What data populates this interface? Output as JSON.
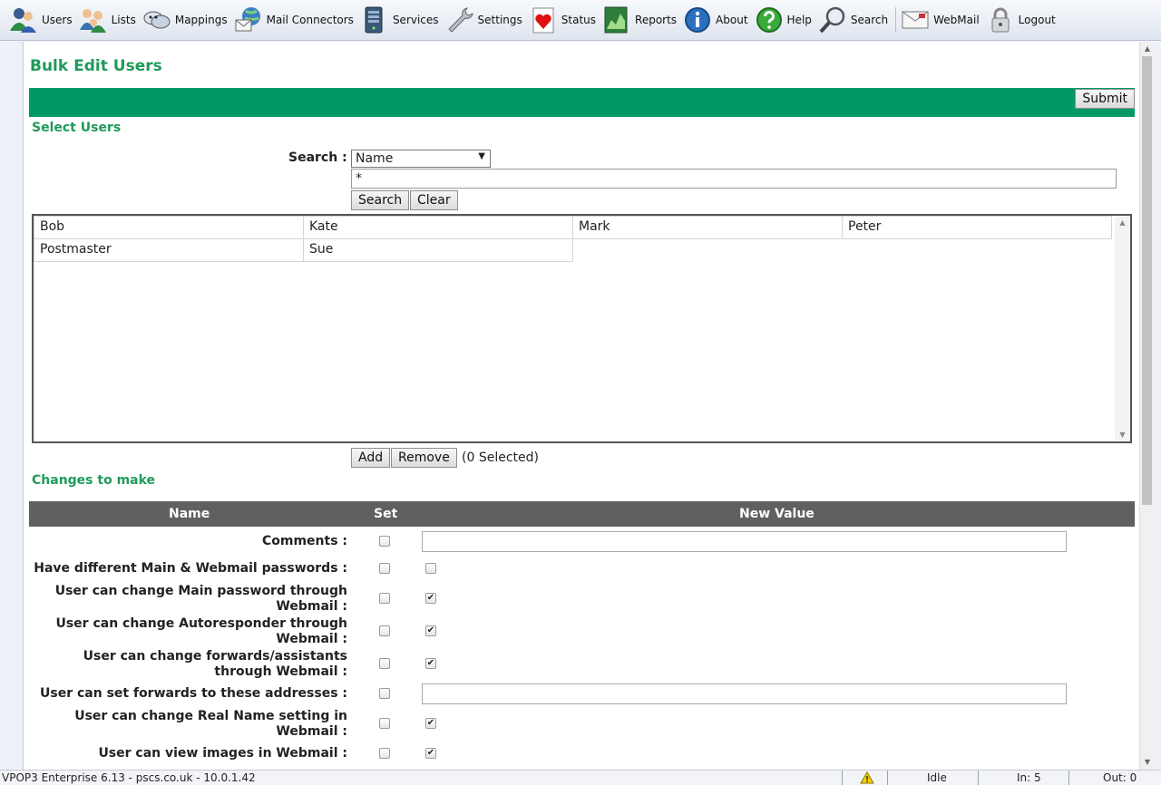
{
  "toolbar": {
    "items": [
      {
        "label": "Users",
        "icon": "users-icon"
      },
      {
        "label": "Lists",
        "icon": "lists-icon"
      },
      {
        "label": "Mappings",
        "icon": "mappings-icon"
      },
      {
        "label": "Mail Connectors",
        "icon": "mail-connectors-icon"
      },
      {
        "label": "Services",
        "icon": "services-icon"
      },
      {
        "label": "Settings",
        "icon": "settings-icon"
      },
      {
        "label": "Status",
        "icon": "status-icon"
      },
      {
        "label": "Reports",
        "icon": "reports-icon"
      },
      {
        "label": "About",
        "icon": "about-icon"
      },
      {
        "label": "Help",
        "icon": "help-icon"
      },
      {
        "label": "Search",
        "icon": "search-icon"
      },
      {
        "label": "WebMail",
        "icon": "webmail-icon"
      },
      {
        "label": "Logout",
        "icon": "logout-icon"
      }
    ]
  },
  "page": {
    "title": "Bulk Edit Users",
    "submit_label": "Submit",
    "select_users_title": "Select Users",
    "changes_title": "Changes to make"
  },
  "search": {
    "label": "Search :",
    "field_selected": "Name",
    "query_value": "*",
    "search_button": "Search",
    "clear_button": "Clear"
  },
  "users": [
    "Bob",
    "Kate",
    "Mark",
    "Peter",
    "Postmaster",
    "Sue"
  ],
  "selection": {
    "add_button": "Add",
    "remove_button": "Remove",
    "selected_text": "(0 Selected)"
  },
  "changes": {
    "headers": {
      "name": "Name",
      "set": "Set",
      "new_value": "New Value"
    },
    "rows": [
      {
        "label": "Comments :",
        "set": false,
        "value_type": "text"
      },
      {
        "label": "Have different Main & Webmail passwords :",
        "set": false,
        "value_type": "checkbox",
        "value": false
      },
      {
        "label": "User can change Main password through Webmail :",
        "set": false,
        "value_type": "checkbox",
        "value": true
      },
      {
        "label": "User can change Autoresponder through Webmail :",
        "set": false,
        "value_type": "checkbox",
        "value": true
      },
      {
        "label": "User can change forwards/assistants through Webmail :",
        "set": false,
        "value_type": "checkbox",
        "value": true
      },
      {
        "label": "User can set forwards to these addresses :",
        "set": false,
        "value_type": "text"
      },
      {
        "label": "User can change Real Name setting in Webmail :",
        "set": false,
        "value_type": "checkbox",
        "value": true
      },
      {
        "label": "User can view images in Webmail :",
        "set": false,
        "value_type": "checkbox",
        "value": true
      }
    ]
  },
  "statusbar": {
    "app_info": "VPOP3 Enterprise 6.13 - pscs.co.uk - 10.0.1.42",
    "warning_icon": "warning-icon",
    "state": "Idle",
    "in_count": "In: 5",
    "out_count": "Out: 0"
  },
  "colors": {
    "accent_green": "#009966",
    "title_green": "#1f9a5a",
    "table_header": "#606060"
  }
}
